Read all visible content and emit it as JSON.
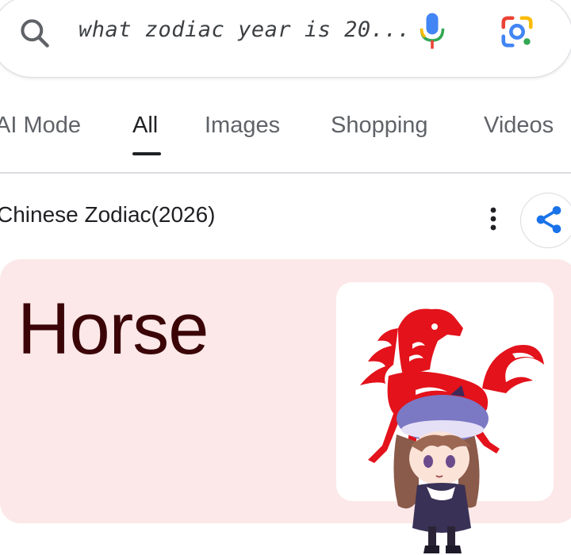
{
  "search": {
    "query": "what zodiac year is 20...",
    "icons": {
      "search": "search-icon",
      "voice": "mic-icon",
      "lens": "google-lens-icon"
    }
  },
  "tabs": [
    {
      "label": "AI Mode",
      "active": false
    },
    {
      "label": "All",
      "active": true
    },
    {
      "label": "Images",
      "active": false
    },
    {
      "label": "Shopping",
      "active": false
    },
    {
      "label": "Videos",
      "active": false
    }
  ],
  "result": {
    "header": "Chinese Zodiac(2026)",
    "answer": "Horse",
    "image": "red-paper-cut-horse",
    "overlay": "chibi-character-sticker",
    "icons": {
      "more": "more-vert-icon",
      "share": "share-icon"
    }
  },
  "colors": {
    "card_background": "#fce8e8",
    "answer_text": "#3b0508",
    "horse_red": "#e3121b",
    "share_blue": "#1a73e8"
  }
}
